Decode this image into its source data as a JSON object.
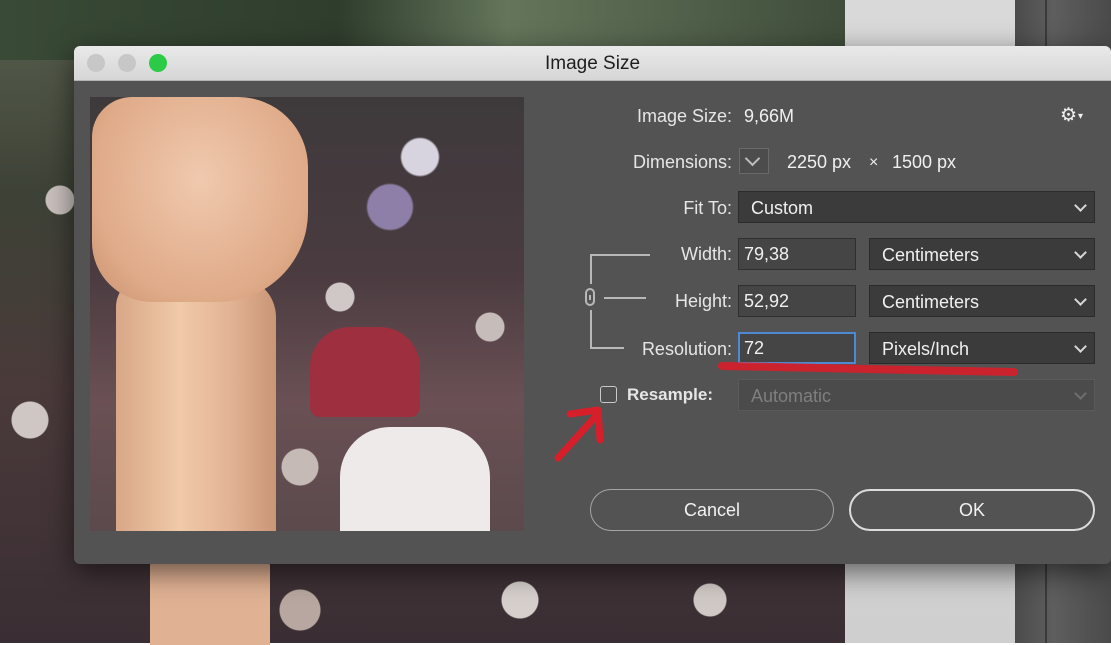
{
  "window": {
    "title": "Image Size"
  },
  "image_size": {
    "label": "Image Size:",
    "value": "9,66M"
  },
  "dimensions": {
    "label": "Dimensions:",
    "width": "2250 px",
    "separator": "×",
    "height": "1500 px"
  },
  "fit_to": {
    "label": "Fit To:",
    "value": "Custom"
  },
  "width": {
    "label": "Width:",
    "value": "79,38",
    "unit": "Centimeters"
  },
  "height": {
    "label": "Height:",
    "value": "52,92",
    "unit": "Centimeters"
  },
  "resolution": {
    "label": "Resolution:",
    "value": "72",
    "unit": "Pixels/Inch"
  },
  "resample": {
    "label": "Resample:",
    "checked": false,
    "value": "Automatic"
  },
  "buttons": {
    "cancel": "Cancel",
    "ok": "OK"
  },
  "icons": {
    "settings": "gear-icon",
    "dimensions_toggle": "chevron-down-icon",
    "constrain": "chain-link-icon",
    "annotation": "red-arrow-icon"
  },
  "colors": {
    "dialog_bg": "#535353",
    "field_bg": "#3b3b3b",
    "focus_ring": "#4e8ad3",
    "traffic_green": "#2ccb47",
    "annotation_red": "#d61f2b"
  }
}
